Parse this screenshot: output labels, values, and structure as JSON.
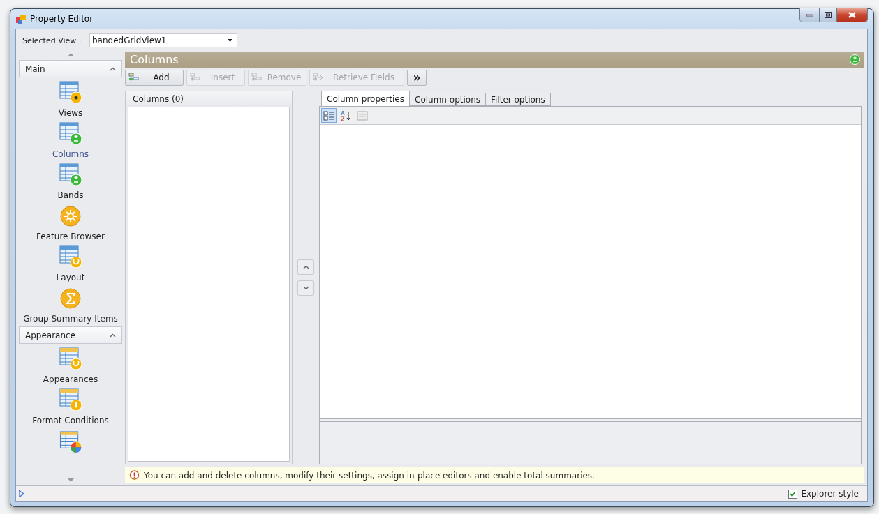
{
  "window": {
    "title": "Property Editor"
  },
  "selected_view": {
    "label": "Selected View :",
    "value": "bandedGridView1"
  },
  "sidebar": {
    "groups": [
      {
        "title": "Main",
        "expanded": true,
        "items": [
          {
            "label": "Views",
            "kind": "views",
            "selected": false
          },
          {
            "label": "Columns",
            "kind": "columns",
            "selected": true
          },
          {
            "label": "Bands",
            "kind": "bands",
            "selected": false
          },
          {
            "label": "Feature Browser",
            "kind": "features",
            "selected": false
          },
          {
            "label": "Layout",
            "kind": "layout",
            "selected": false
          },
          {
            "label": "Group Summary Items",
            "kind": "summary",
            "selected": false
          }
        ]
      },
      {
        "title": "Appearance",
        "expanded": true,
        "items": [
          {
            "label": "Appearances",
            "kind": "appearances",
            "selected": false
          },
          {
            "label": "Format Conditions",
            "kind": "format",
            "selected": false
          },
          {
            "kind": "chart"
          }
        ]
      }
    ]
  },
  "page": {
    "title": "Columns"
  },
  "toolbar": [
    {
      "label": "Add",
      "kind": "add",
      "disabled": false
    },
    {
      "label": "Insert",
      "kind": "insert",
      "disabled": true
    },
    {
      "label": "Remove",
      "kind": "remove",
      "disabled": true
    },
    {
      "label": "Retrieve Fields",
      "kind": "retrieve",
      "disabled": true
    },
    {
      "label": "»",
      "kind": "more",
      "disabled": false
    }
  ],
  "columns_list": {
    "header": "Columns (0)"
  },
  "tabs": [
    {
      "label": "Column properties",
      "selected": true
    },
    {
      "label": "Column options",
      "selected": false
    },
    {
      "label": "Filter options",
      "selected": false
    }
  ],
  "property_toolbar": [
    {
      "kind": "categorized",
      "selected": true
    },
    {
      "kind": "alphabetical",
      "selected": false
    },
    {
      "kind": "pages",
      "selected": false
    }
  ],
  "hint": "You can add and delete columns, modify their settings, assign in-place editors and enable total summaries.",
  "status_bar": {
    "explorer_style": {
      "label": "Explorer style",
      "checked": true
    }
  }
}
